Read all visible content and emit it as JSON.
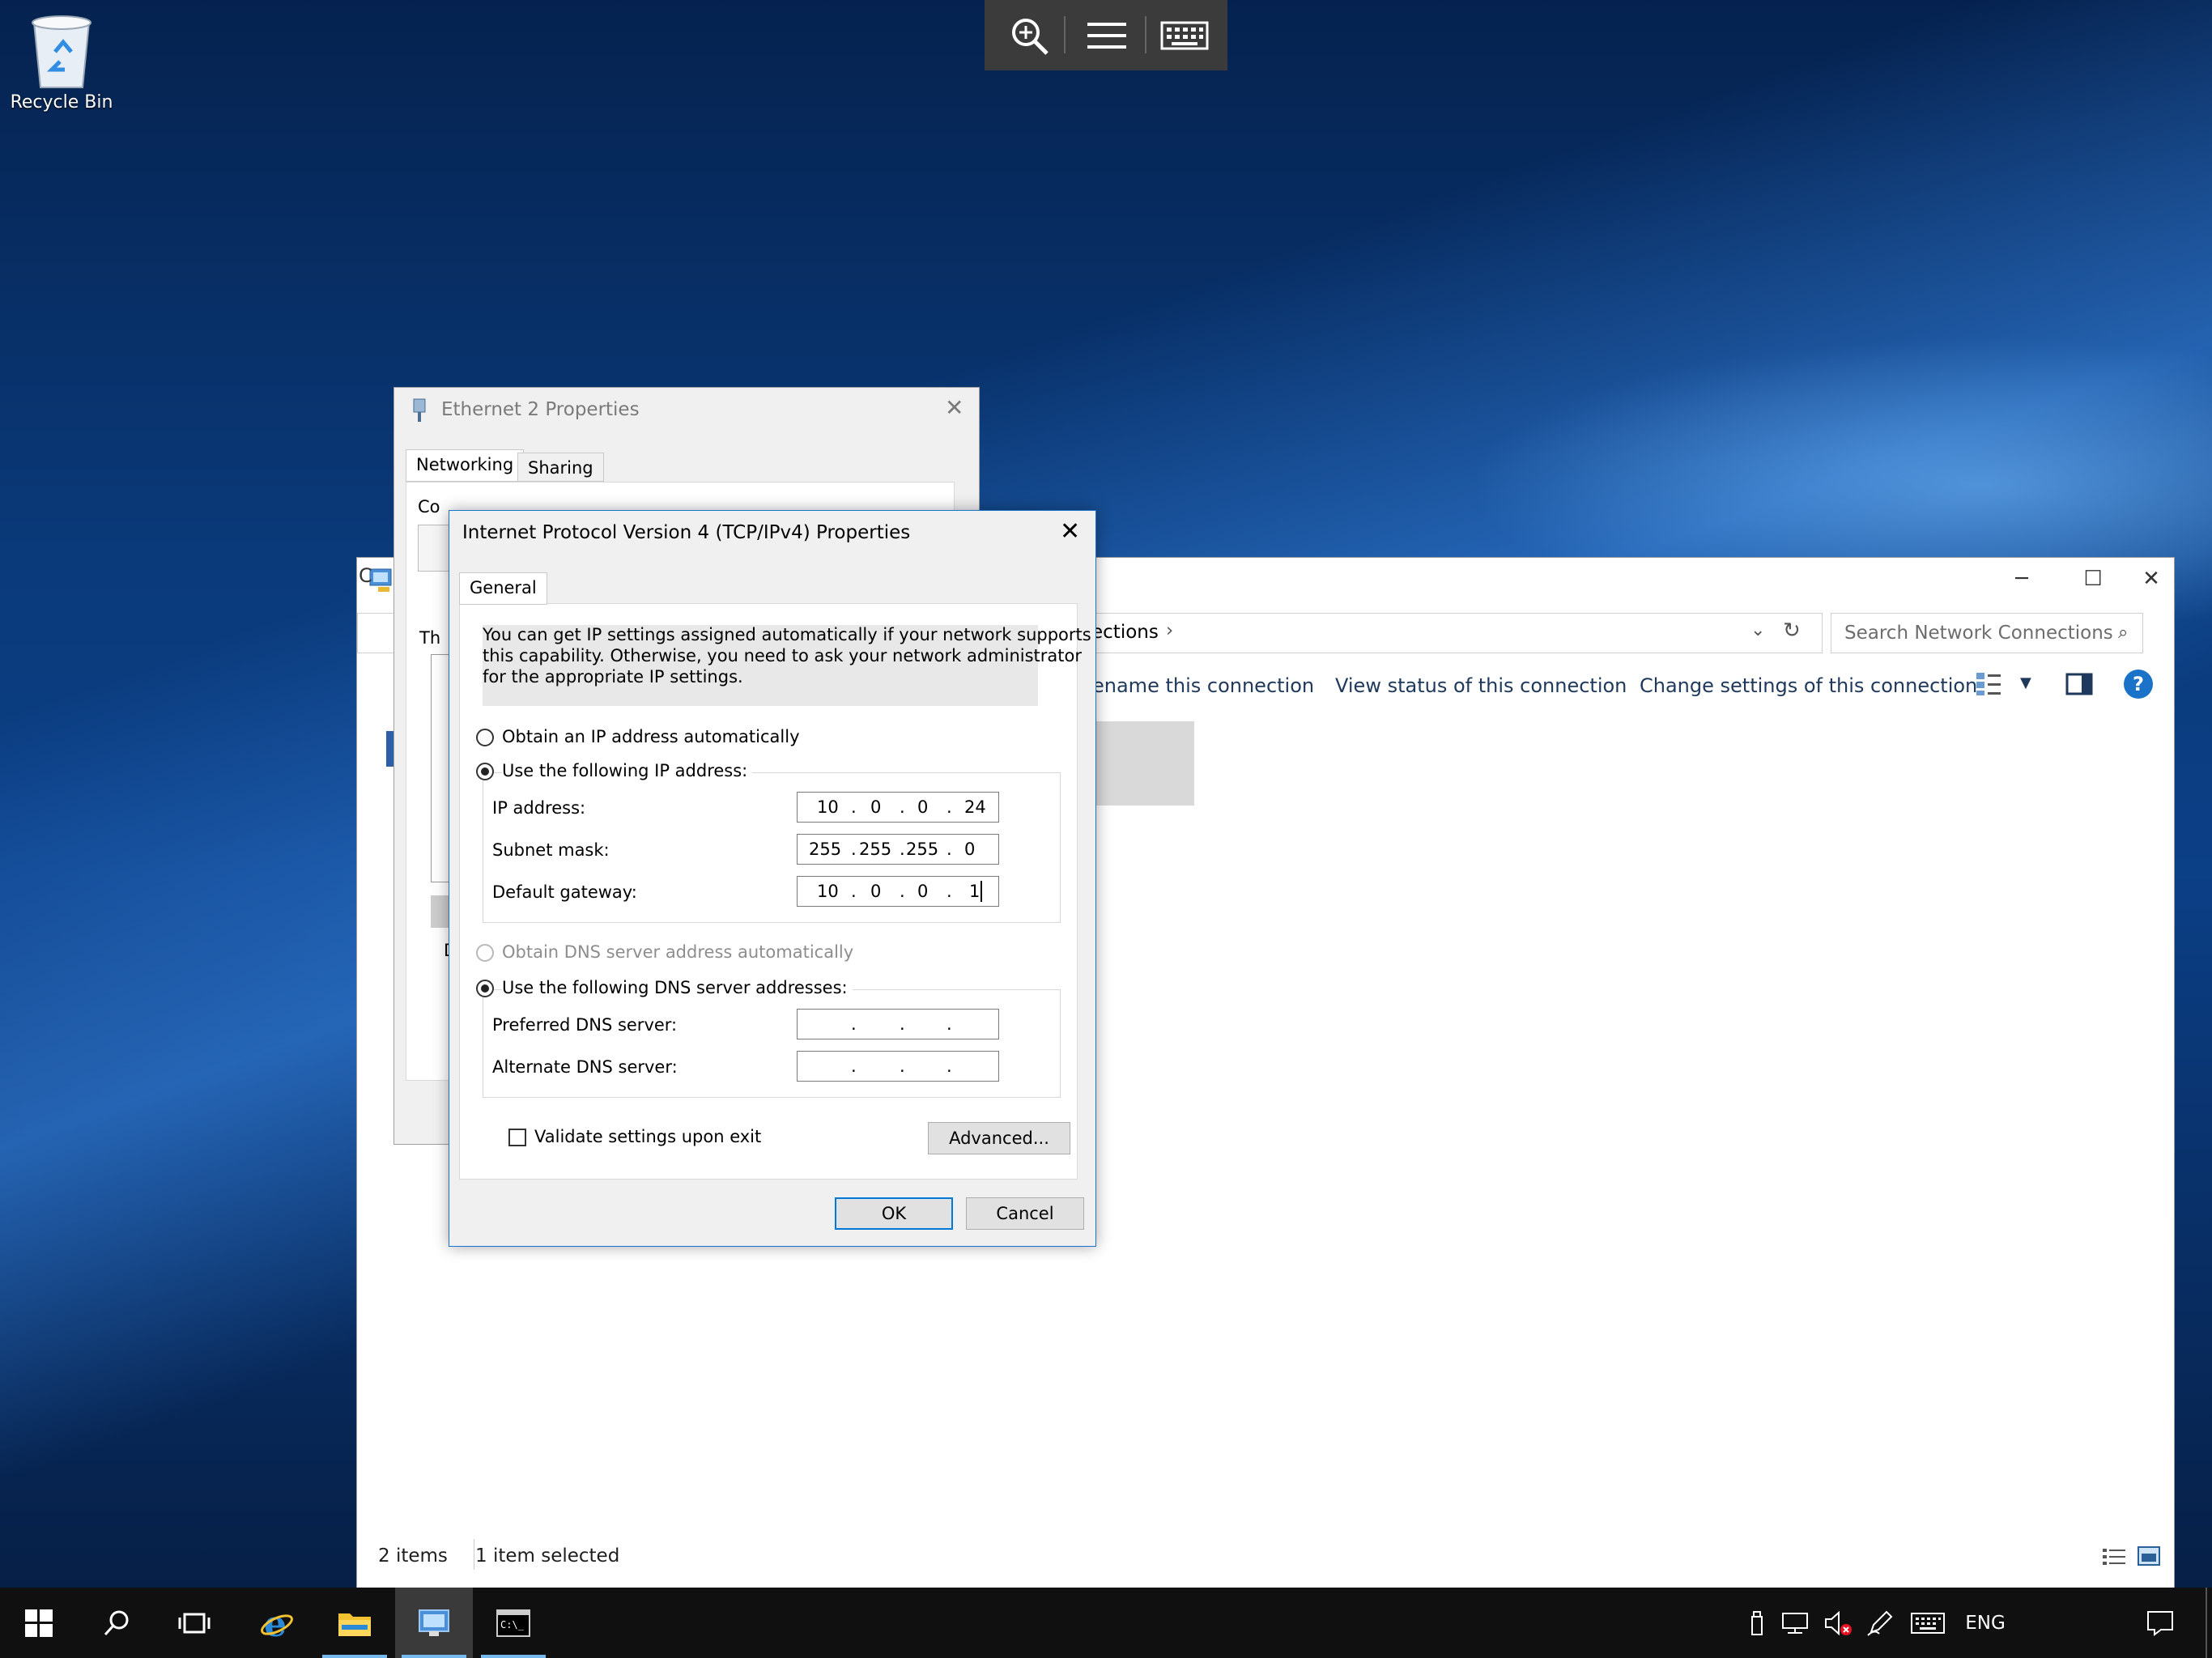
{
  "desktop": {
    "recycle_bin_label": "Recycle Bin"
  },
  "zoom_toolbar": {
    "icons": [
      "zoom-icon",
      "menu-icon",
      "keyboard-icon"
    ]
  },
  "explorer": {
    "address_partial": "ections",
    "address_chevron": "›",
    "search_placeholder": "Search Network Connections",
    "commands": {
      "rename": "ename this connection",
      "view_status": "View status of this connection",
      "change_settings": "Change settings of this connection"
    },
    "status": {
      "items": "2 items",
      "selected": "1 item selected"
    },
    "left_fragments": {
      "a": "Th",
      "b": "C"
    }
  },
  "ethernet_props": {
    "title": "Ethernet 2 Properties",
    "tabs": [
      "Networking",
      "Sharing"
    ],
    "connect_partial": "Co",
    "d_partial": "D"
  },
  "ipv4": {
    "title": "Internet Protocol Version 4 (TCP/IPv4) Properties",
    "tab": "General",
    "description": "You can get IP settings assigned automatically if your network supports this capability. Otherwise, you need to ask your network administrator for the appropriate IP settings.",
    "desc_line1": "You can get IP settings assigned automatically if your network supports",
    "desc_line2": "this capability. Otherwise, you need to ask your network administrator",
    "desc_line3": "for the appropriate IP settings.",
    "obtain_ip_auto": "Obtain an IP address automatically",
    "use_ip": "Use the following IP address:",
    "ip_label": "IP address:",
    "ip": [
      "10",
      "0",
      "0",
      "24"
    ],
    "subnet_label": "Subnet mask:",
    "subnet": [
      "255",
      "255",
      "255",
      "0"
    ],
    "gateway_label": "Default gateway:",
    "gateway": [
      "10",
      "0",
      "0",
      "1"
    ],
    "obtain_dns_auto": "Obtain DNS server address automatically",
    "use_dns": "Use the following DNS server addresses:",
    "preferred_dns_label": "Preferred DNS server:",
    "alternate_dns_label": "Alternate DNS server:",
    "dot": ".",
    "validate_label": "Validate settings upon exit",
    "advanced_label": "Advanced...",
    "ok_label": "OK",
    "cancel_label": "Cancel",
    "selection": {
      "ip_mode": "manual",
      "dns_mode": "manual",
      "validate_checked": false
    }
  },
  "taskbar": {
    "language": "ENG",
    "active_app": "network-connections"
  },
  "colors": {
    "accent": "#0078d7",
    "taskbar": "#101010",
    "link": "#1e395b"
  }
}
